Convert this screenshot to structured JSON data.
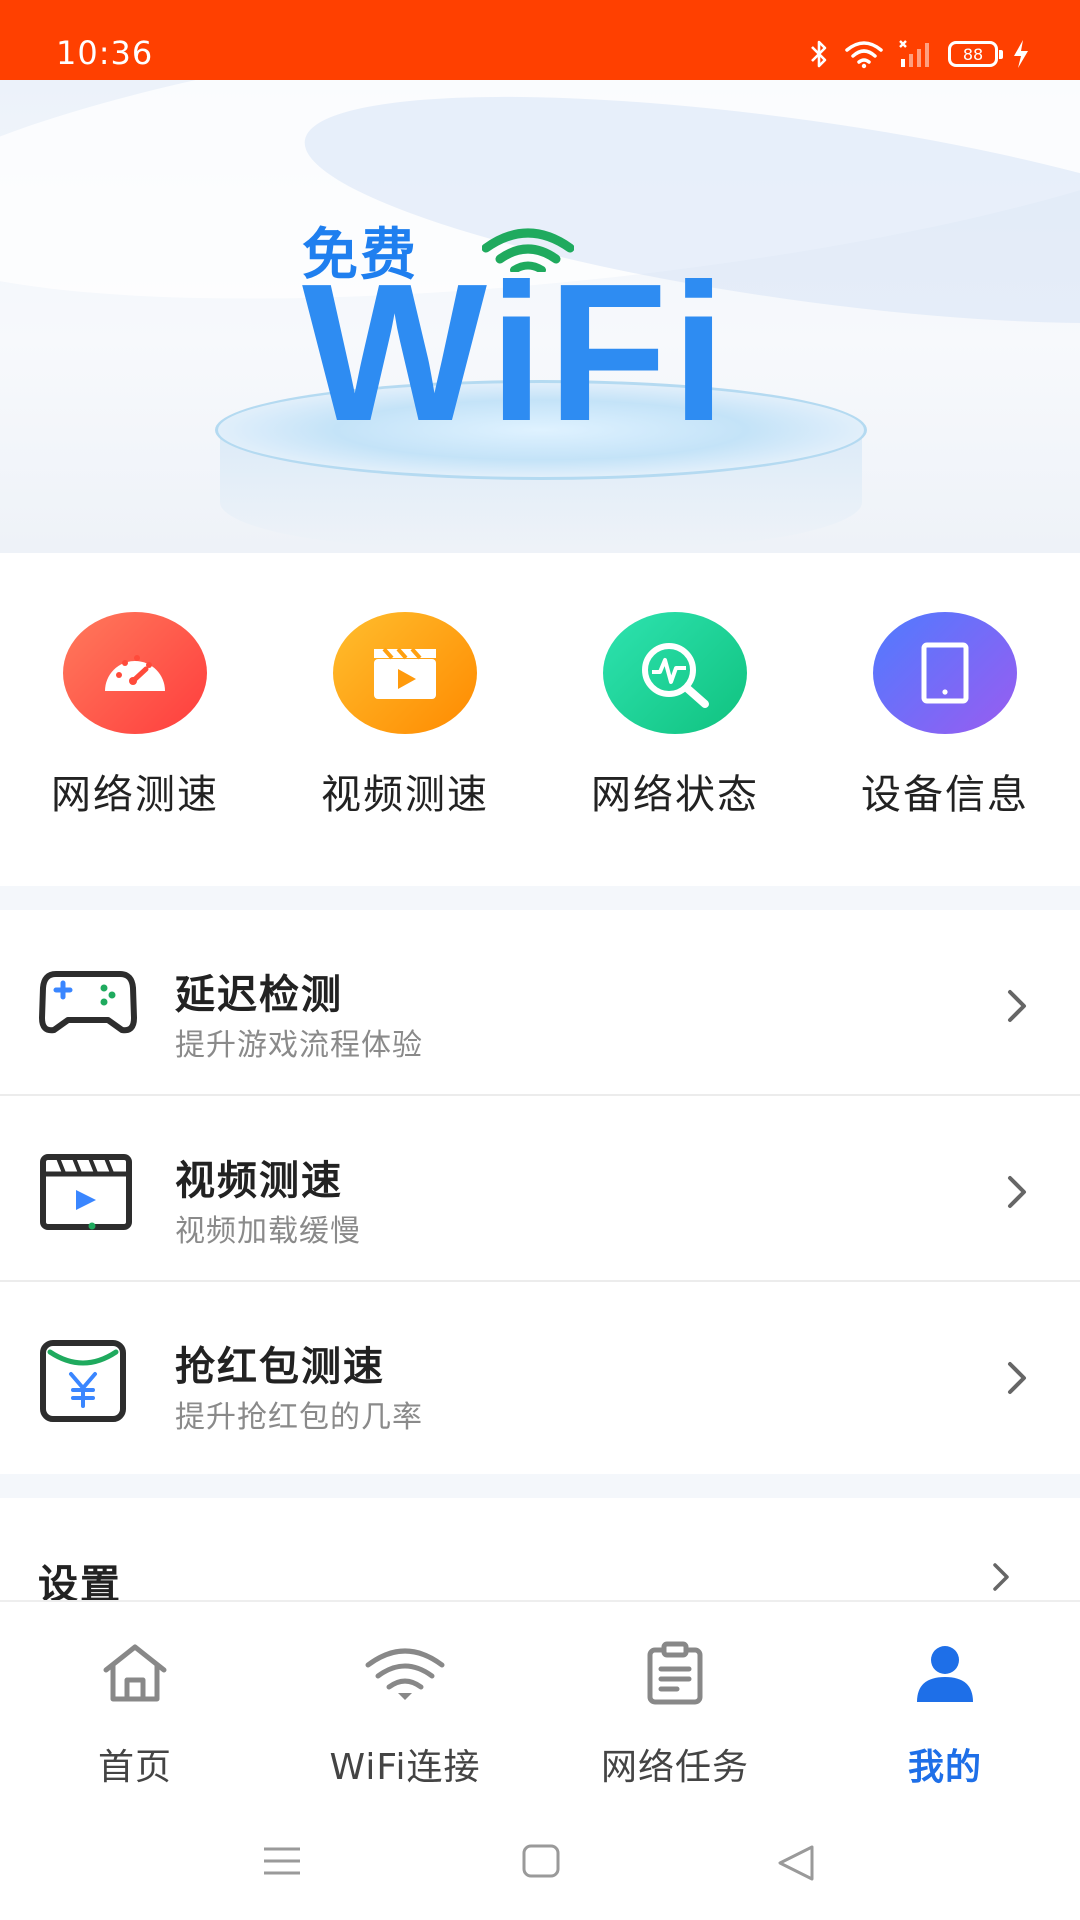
{
  "status_bar": {
    "time": "10:36",
    "battery": "88"
  },
  "banner": {
    "logo_small": "免费",
    "logo_big": "WiFi"
  },
  "tools": [
    {
      "label": "网络测速",
      "icon": "speedometer-icon",
      "gradient": [
        "#ff7a5c",
        "#ff3d3d"
      ]
    },
    {
      "label": "视频测速",
      "icon": "video-clapper-icon",
      "gradient": [
        "#ffbe2e",
        "#ff8a00"
      ]
    },
    {
      "label": "网络状态",
      "icon": "network-search-icon",
      "gradient": [
        "#2ee3b0",
        "#10c27f"
      ]
    },
    {
      "label": "设备信息",
      "icon": "tablet-icon",
      "gradient": [
        "#4f7bff",
        "#9a5cf0"
      ]
    }
  ],
  "list": [
    {
      "title": "延迟检测",
      "subtitle": "提升游戏流程体验",
      "icon": "gamepad-icon"
    },
    {
      "title": "视频测速",
      "subtitle": "视频加载缓慢",
      "icon": "video-play-icon"
    },
    {
      "title": "抢红包测速",
      "subtitle": "提升抢红包的几率",
      "icon": "red-packet-yuan-icon"
    }
  ],
  "settings": {
    "label": "设置"
  },
  "bottom_nav": [
    {
      "label": "首页",
      "icon": "home-icon",
      "active": false
    },
    {
      "label": "WiFi连接",
      "icon": "wifi-icon",
      "active": false
    },
    {
      "label": "网络任务",
      "icon": "clipboard-icon",
      "active": false
    },
    {
      "label": "我的",
      "icon": "user-icon",
      "active": true
    }
  ],
  "colors": {
    "status_bar": "#ff4000",
    "accent": "#1e6fe8",
    "logo_blue": "#2e8cf2",
    "wifi_green": "#1faa5e"
  }
}
